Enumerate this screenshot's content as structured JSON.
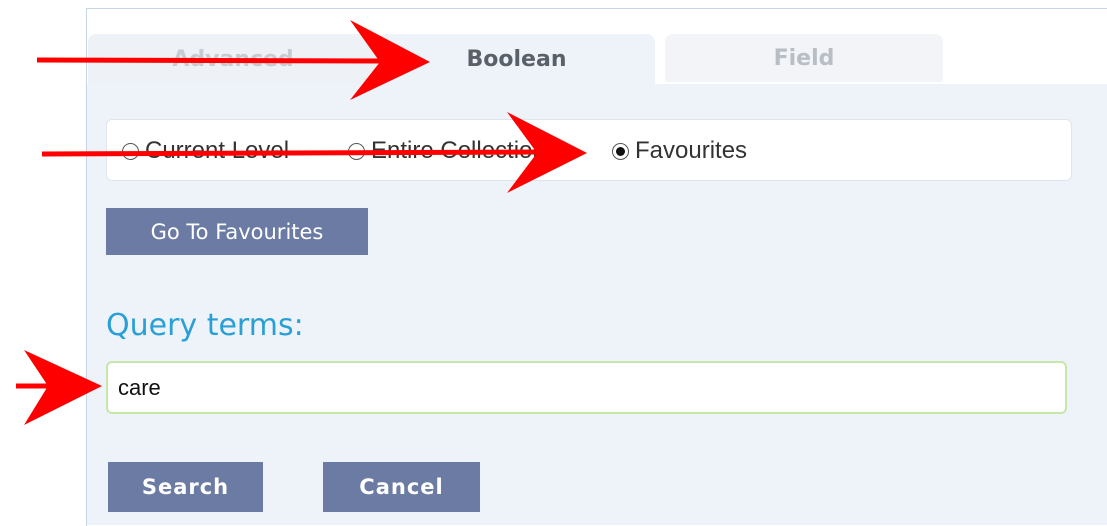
{
  "tabs": [
    {
      "label": "Advanced"
    },
    {
      "label": "Boolean"
    },
    {
      "label": "Field"
    }
  ],
  "scope": {
    "options": [
      {
        "label": "Current Level",
        "checked": false
      },
      {
        "label": "Entire Collection",
        "checked": false
      },
      {
        "label": "Favourites",
        "checked": true
      }
    ]
  },
  "favourites_button": {
    "label": "Go To Favourites"
  },
  "query": {
    "label": "Query terms:",
    "value": "care"
  },
  "actions": {
    "search_label": "Search",
    "cancel_label": "Cancel"
  },
  "annotations": {
    "arrow_color": "#ff0000",
    "arrow_icon": "red-arrow-icon"
  },
  "colors": {
    "button_bg": "#6b7ba3",
    "panel_bg": "#eef3f9",
    "query_label": "#2a9fd6",
    "input_border": "#c5e8a8"
  }
}
